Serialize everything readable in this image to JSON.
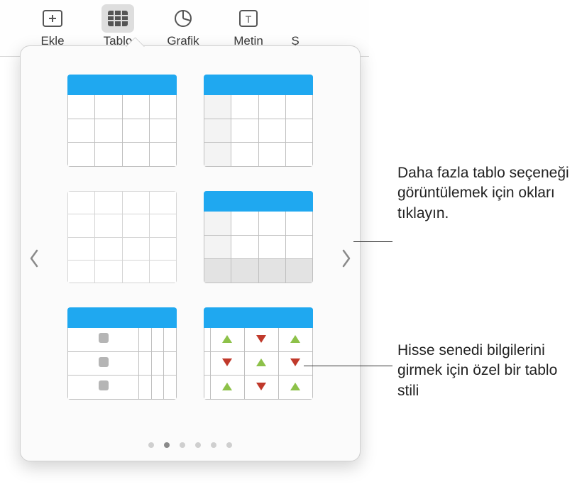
{
  "toolbar": {
    "items": [
      {
        "label": "Ekle",
        "icon": "insert-icon"
      },
      {
        "label": "Tablo",
        "icon": "table-icon",
        "active": true
      },
      {
        "label": "Grafik",
        "icon": "chart-icon"
      },
      {
        "label": "Metin",
        "icon": "text-icon"
      },
      {
        "label": "Ş",
        "icon": "shape-icon"
      }
    ]
  },
  "popover": {
    "page_dots": {
      "count": 6,
      "active_index": 1
    },
    "style_names": [
      "table-style-blue-header",
      "table-style-blue-header-firstcol",
      "table-style-plain",
      "table-style-header-footer",
      "table-style-checkbox",
      "table-style-stock"
    ]
  },
  "callouts": {
    "arrows": "Daha fazla tablo seçeneği görüntülemek için okları tıklayın.",
    "stock": "Hisse senedi bilgilerini girmek için özel bir tablo stili"
  }
}
